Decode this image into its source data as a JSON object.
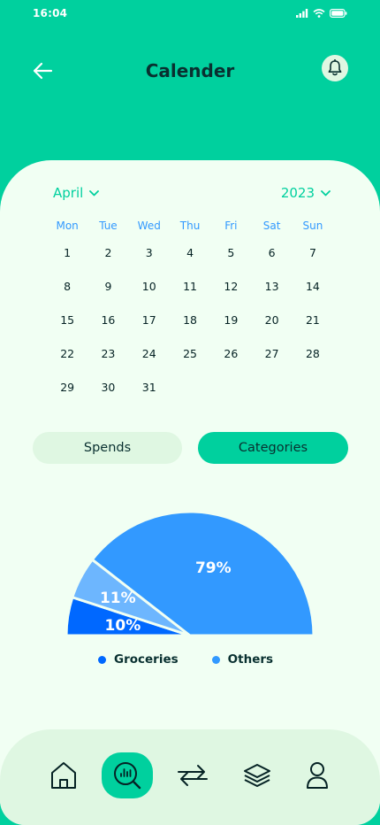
{
  "status": {
    "time": "16:04"
  },
  "header": {
    "title": "Calender"
  },
  "calendar": {
    "month": "April",
    "year": "2023",
    "weekdays": [
      "Mon",
      "Tue",
      "Wed",
      "Thu",
      "Fri",
      "Sat",
      "Sun"
    ],
    "weeks": [
      [
        "1",
        "2",
        "3",
        "4",
        "5",
        "6",
        "7"
      ],
      [
        "8",
        "9",
        "10",
        "11",
        "12",
        "13",
        "14"
      ],
      [
        "15",
        "16",
        "17",
        "18",
        "19",
        "20",
        "21"
      ],
      [
        "22",
        "23",
        "24",
        "25",
        "26",
        "27",
        "28"
      ],
      [
        "29",
        "30",
        "31"
      ]
    ]
  },
  "tabs": {
    "spends": "Spends",
    "categories": "Categories",
    "active": "categories"
  },
  "chart_data": {
    "type": "pie",
    "slices": [
      {
        "label": "10%",
        "value": 10,
        "color": "#0068FF"
      },
      {
        "label": "11%",
        "value": 11,
        "color": "#6DB6FE"
      },
      {
        "label": "79%",
        "value": 79,
        "color": "#3299FF"
      }
    ],
    "legend": [
      {
        "name": "Groceries",
        "color": "#0068FF"
      },
      {
        "name": "Others",
        "color": "#3299FF"
      }
    ]
  },
  "nav": {
    "items": [
      "home-icon",
      "analysis-icon",
      "transactions-icon",
      "layers-icon",
      "profile-icon"
    ],
    "active": "analysis-icon"
  },
  "colors": {
    "primary": "#00D09E",
    "sheet": "#F1FFF3",
    "light": "#DFF7E2",
    "dark": "#093030",
    "blue": "#3299FF"
  }
}
